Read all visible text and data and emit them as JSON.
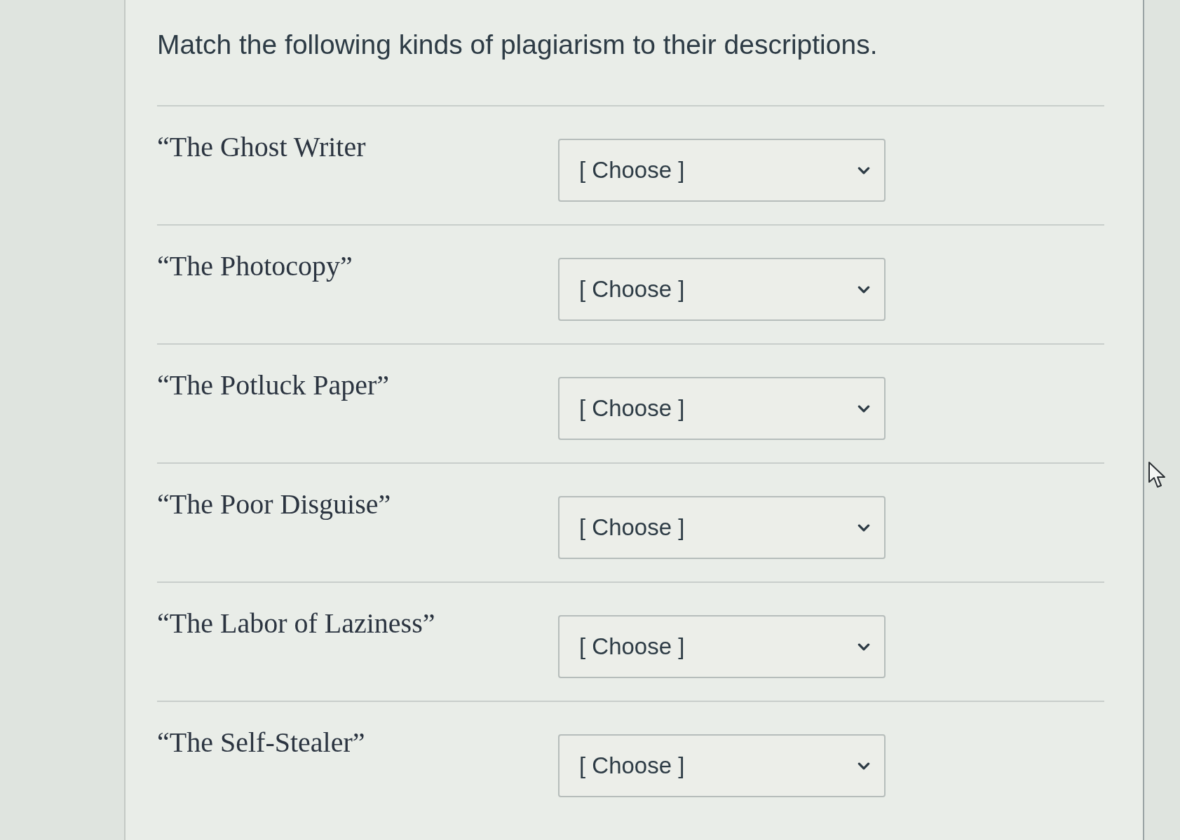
{
  "question": {
    "prompt": "Match the following kinds of plagiarism to their descriptions."
  },
  "items": [
    {
      "term": "“The Ghost Writer",
      "choice": "[ Choose ]"
    },
    {
      "term": "“The Photocopy”",
      "choice": "[ Choose ]"
    },
    {
      "term": "“The Potluck Paper”",
      "choice": "[ Choose ]"
    },
    {
      "term": "“The Poor Disguise”",
      "choice": "[ Choose ]"
    },
    {
      "term": "“The Labor of Laziness”",
      "choice": "[ Choose ]"
    },
    {
      "term": "“The Self-Stealer”",
      "choice": "[ Choose ]"
    }
  ]
}
